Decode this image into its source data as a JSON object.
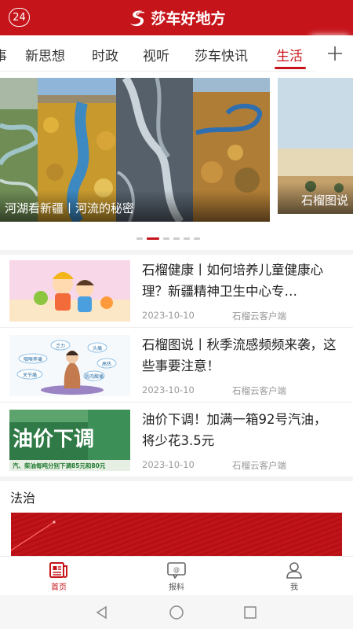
{
  "header": {
    "badge": "24",
    "title": "莎车好地方"
  },
  "tabs": [
    {
      "label": "事"
    },
    {
      "label": "新思想"
    },
    {
      "label": "时政"
    },
    {
      "label": "视听"
    },
    {
      "label": "莎车快讯"
    },
    {
      "label": "生活",
      "active": true
    }
  ],
  "carousel": {
    "main_caption": "河湖看新疆丨河流的秘密",
    "side_caption": "石榴图说",
    "dots": 6,
    "active_dot": 1
  },
  "news": [
    {
      "title": "石榴健康丨如何培养儿童健康心理？新疆精神卫生中心专…",
      "date": "2023-10-10",
      "source": "石榴云客户端"
    },
    {
      "title": "石榴图说丨秋季流感频频来袭，这些事要注意！",
      "date": "2023-10-10",
      "source": "石榴云客户端",
      "thumb_labels": [
        "头痛",
        "咽喉疼痛",
        "乏力",
        "肌肉酸痛",
        "高热",
        "关节痛"
      ]
    },
    {
      "title": "油价下调！加满一箱92号汽油，将少花3.5元",
      "date": "2023-10-10",
      "source": "石榴云客户端",
      "thumb_headline": "油价下调",
      "thumb_sub": "汽、柴油每吨分别下调85元和80元"
    }
  ],
  "section": {
    "title": "法治"
  },
  "bottom_nav": [
    {
      "label": "首页",
      "icon": "newspaper-icon",
      "active": true
    },
    {
      "label": "报料",
      "icon": "chat-icon"
    },
    {
      "label": "我",
      "icon": "user-icon"
    }
  ],
  "colors": {
    "brand_red": "#c5151b",
    "text": "#222222",
    "meta": "#999999"
  }
}
